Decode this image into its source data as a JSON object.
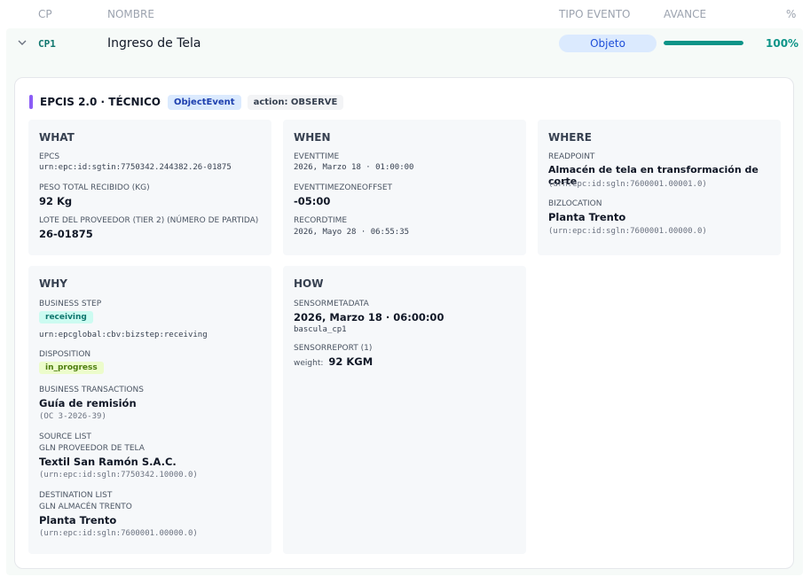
{
  "table": {
    "headers": {
      "cp": "CP",
      "nombre": "NOMBRE",
      "tipo_evento": "TIPO EVENTO",
      "avance": "AVANCE",
      "pct": "%"
    },
    "row": {
      "cp": "CP1",
      "nombre": "Ingreso de Tela",
      "tipo_evento": "Objeto",
      "avance_fraction": 1.0,
      "pct": "100%"
    }
  },
  "card": {
    "title": "EPCIS 2.0 · TÉCNICO",
    "badge_type": "ObjectEvent",
    "badge_action": "action: OBSERVE"
  },
  "what": {
    "title": "WHAT",
    "epcs_label": "EPCS",
    "epcs_value": "urn:epc:id:sgtin:7750342.244382.26-01875",
    "peso_label": "PESO TOTAL RECIBIDO (KG)",
    "peso_value": "92 Kg",
    "lote_label": "LOTE DEL PROVEEDOR (TIER 2) (NÚMERO DE PARTIDA)",
    "lote_value": "26-01875"
  },
  "when": {
    "title": "WHEN",
    "eventtime_label": "EVENTTIME",
    "eventtime_value": "2026, Marzo 18 · 01:00:00",
    "tz_label": "EVENTTIMEZONEOFFSET",
    "tz_value": "-05:00",
    "recordtime_label": "RECORDTIME",
    "recordtime_value": "2026, Mayo 28 · 06:55:35"
  },
  "where": {
    "title": "WHERE",
    "readpoint_label": "READPOINT",
    "readpoint_value": "Almacén de tela en transformación de corte",
    "readpoint_urn": "(urn:epc:id:sgln:7600001.00001.0)",
    "bizlocation_label": "BIZLOCATION",
    "bizlocation_value": "Planta Trento",
    "bizlocation_urn": "(urn:epc:id:sgln:7600001.00000.0)"
  },
  "why": {
    "title": "WHY",
    "bizstep_label": "BUSINESS STEP",
    "bizstep_tag": "receiving",
    "bizstep_urn": "urn:epcglobal:cbv:bizstep:receiving",
    "disposition_label": "DISPOSITION",
    "disposition_tag": "in_progress",
    "transactions_label": "BUSINESS TRANSACTIONS",
    "transactions_value": "Guía de remisión",
    "transactions_ref": "(OC 3-2026-39)",
    "source_label": "SOURCE LIST",
    "source_sub": "GLN PROVEEDOR DE TELA",
    "source_value": "Textil San Ramón S.A.C.",
    "source_urn": "(urn:epc:id:sgln:7750342.10000.0)",
    "dest_label": "DESTINATION LIST",
    "dest_sub": "GLN ALMACÉN TRENTO",
    "dest_value": "Planta Trento",
    "dest_urn": "(urn:epc:id:sgln:7600001.00000.0)"
  },
  "how": {
    "title": "HOW",
    "meta_label": "SENSORMETADATA",
    "meta_value": "2026, Marzo 18 · 06:00:00",
    "meta_device": "bascula_cp1",
    "report_label": "SENSORREPORT (1)",
    "report_key": "weight:",
    "report_value": "92 KGM"
  },
  "colors": {
    "accent": "#8b5cf6",
    "progress": "#0d9488",
    "pill_bg": "#dbeafe"
  },
  "icons": {
    "expand": "chevron-down-icon"
  }
}
